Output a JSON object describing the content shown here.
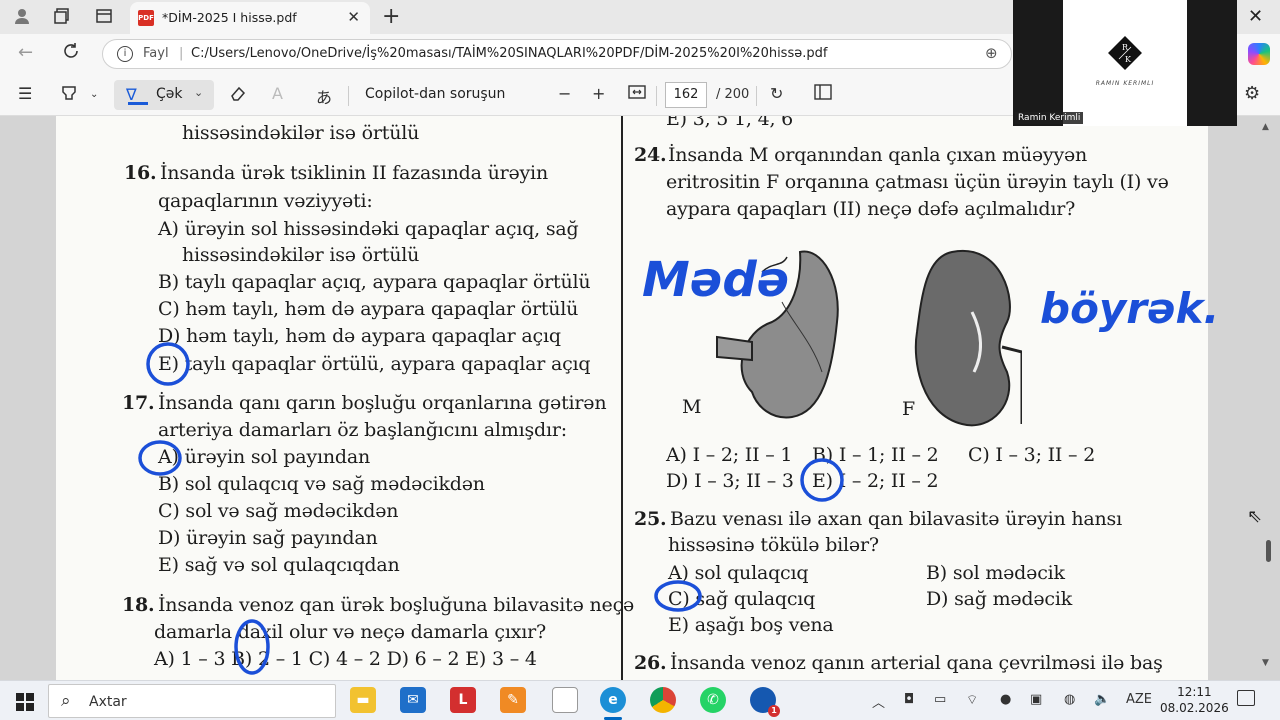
{
  "tab": {
    "title": "*DİM-2025 I hissə.pdf",
    "badge": "PDF"
  },
  "address": {
    "label": "Fayl",
    "separator": "|",
    "url": "C:/Users/Lenovo/OneDrive/İş%20masası/TAİM%20SINAQLARI%20PDF/DİM-2025%20I%20hissə.pdf"
  },
  "pdf_toolbar": {
    "draw_label": "Çək",
    "copilot_label": "Copilot-dan soruşun",
    "current_page": "162",
    "total_pages": "/ 200"
  },
  "document": {
    "left_column": [
      {
        "text": "hissəsindəkilər isə örtülü"
      },
      {
        "num": "16.",
        "text": "İnsanda ürək tsiklinin II fazasında ürəyin"
      },
      {
        "text": "qapaqlarının vəziyyəti:"
      },
      {
        "text": "A) ürəyin sol hissəsindəki qapaqlar açıq, sağ"
      },
      {
        "text": "hissəsindəkilər isə örtülü"
      },
      {
        "text": "B) taylı qapaqlar açıq, aypara qapaqlar örtülü"
      },
      {
        "text": "C) həm taylı, həm də aypara qapaqlar örtülü"
      },
      {
        "text": "D) həm taylı, həm də aypara qapaqlar açıq"
      },
      {
        "text": "E) taylı qapaqlar örtülü, aypara qapaqlar açıq"
      },
      {
        "num": "17.",
        "text": "İnsanda qanı qarın boşluğu orqanlarına gətirən"
      },
      {
        "text": "arteriya damarları öz başlanğıcını almışdır:"
      },
      {
        "text": "A) ürəyin sol payından"
      },
      {
        "text": "B) sol qulaqcıq və sağ mədəcikdən"
      },
      {
        "text": "C) sol və sağ mədəcikdən"
      },
      {
        "text": "D) ürəyin sağ payından"
      },
      {
        "text": "E) sağ və sol qulaqcıqdan"
      },
      {
        "num": "18.",
        "text": "İnsanda venoz qan ürək boşluğuna bilavasitə neçə"
      },
      {
        "text": "damarla daxil olur və neçə damarla çıxır?"
      },
      {
        "text": "A) 1 – 3   B) 2 – 1   C) 4 – 2   D) 6 – 2   E) 3 – 4"
      }
    ],
    "right_column": [
      {
        "text": "E)  3, 5            1, 4, 6"
      },
      {
        "num": "24.",
        "text": "İnsanda M orqanından qanla çıxan müəyyən"
      },
      {
        "text": "eritrositin F orqanına çatması üçün ürəyin taylı (I) və"
      },
      {
        "text": "aypara qapaqları (II) neçə dəfə açılmalıdır?"
      },
      {
        "text": "M"
      },
      {
        "text": "F"
      },
      {
        "text": "A) I – 2; II – 1"
      },
      {
        "text": "B) I – 1; II – 2"
      },
      {
        "text": "C) I – 3; II – 2"
      },
      {
        "text": "D) I – 3; II – 3"
      },
      {
        "text": "E) I – 2; II – 2"
      },
      {
        "num": "25.",
        "text": "Bazu venası ilə axan qan bilavasitə ürəyin hansı"
      },
      {
        "text": "hissəsinə tökülə bilər?"
      },
      {
        "text": "A) sol qulaqcıq"
      },
      {
        "text": "B) sol mədəcik"
      },
      {
        "text": "C) sağ qulaqcıq"
      },
      {
        "text": "D) sağ mədəcik"
      },
      {
        "text": "E) aşağı boş vena"
      },
      {
        "num": "26.",
        "text": "İnsanda venoz qanın arterial qana çevrilməsi ilə baş"
      }
    ],
    "handwriting": {
      "left_note": "Mədə",
      "right_note": "böyrək."
    }
  },
  "webcam": {
    "name": "Ramin Kerimli",
    "logo_letters": "R / K",
    "logo_caption": "RAMIN KERIMLI"
  },
  "taskbar": {
    "search_placeholder": "Axtar",
    "language": "AZE",
    "time": "12:11",
    "date": "08.02.2026",
    "edge_badge": "1"
  },
  "colors": {
    "annotation_blue": "#1b4fd8",
    "pdf_red": "#d93025",
    "accent": "#0067c0"
  }
}
